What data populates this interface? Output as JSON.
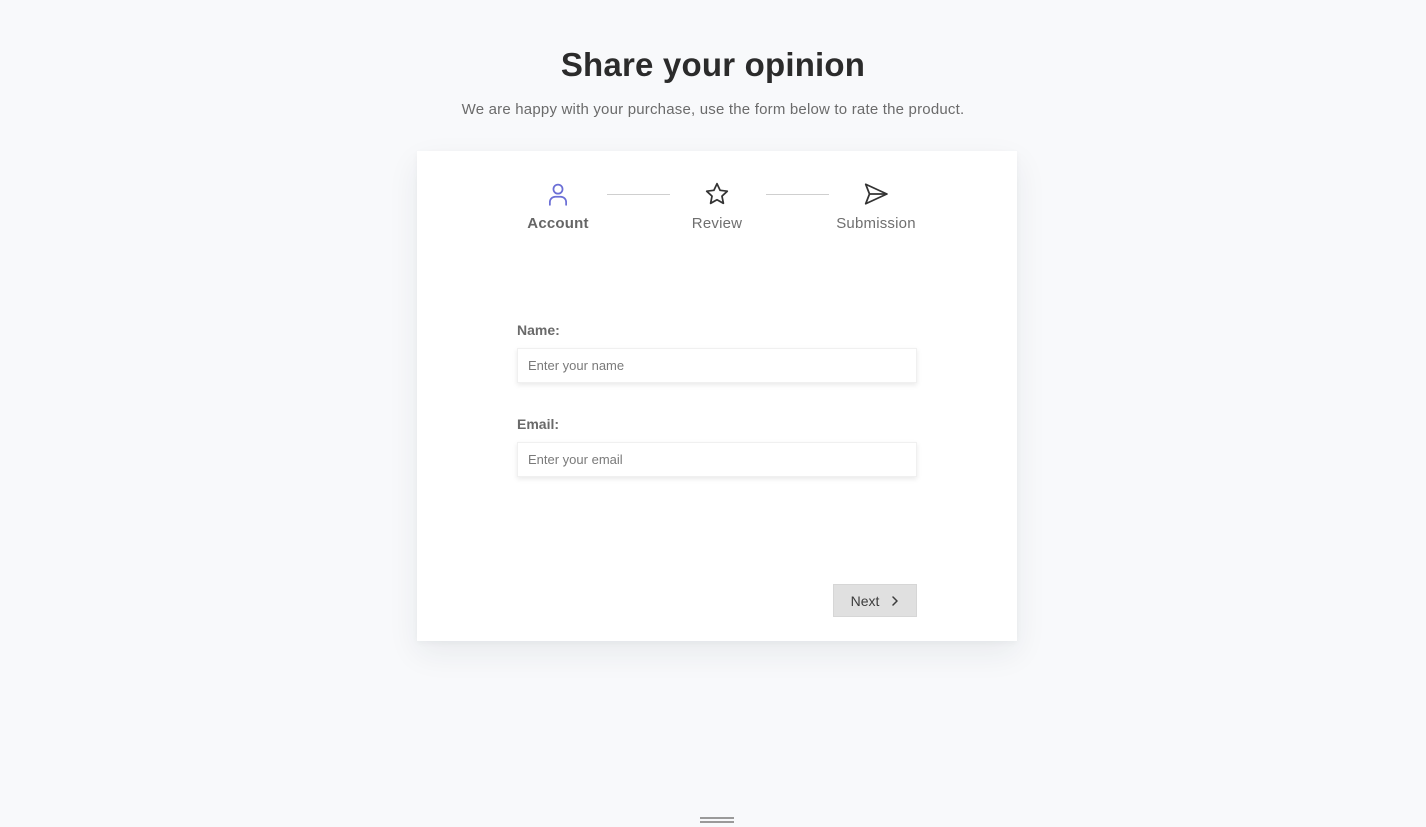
{
  "header": {
    "title": "Share your opinion",
    "subtitle": "We are happy with your purchase, use the form below to rate the product."
  },
  "stepper": {
    "active_index": 0,
    "accent_color": "#6b6fd6",
    "steps": [
      {
        "label": "Account",
        "icon": "user-icon"
      },
      {
        "label": "Review",
        "icon": "star-icon"
      },
      {
        "label": "Submission",
        "icon": "send-icon"
      }
    ]
  },
  "form": {
    "name": {
      "label": "Name:",
      "placeholder": "Enter your name",
      "value": ""
    },
    "email": {
      "label": "Email:",
      "placeholder": "Enter your email",
      "value": ""
    }
  },
  "actions": {
    "next_label": "Next",
    "next_icon": "chevron-right-icon"
  },
  "colors": {
    "background": "#f8f9fb",
    "card": "#ffffff",
    "button_bg": "#e0e0e0"
  }
}
